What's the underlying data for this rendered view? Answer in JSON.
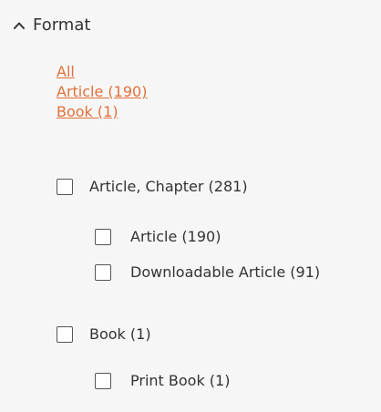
{
  "facet": {
    "title": "Format",
    "quick_links": [
      "All",
      "Article (190)",
      "Book (1)"
    ],
    "options": [
      {
        "label": "Article, Chapter (281)",
        "checked": false,
        "children": [
          {
            "label": "Article (190)",
            "checked": false
          },
          {
            "label": "Downloadable Article (91)",
            "checked": false
          }
        ]
      },
      {
        "label": "Book (1)",
        "checked": false,
        "children": [
          {
            "label": "Print Book (1)",
            "checked": false
          }
        ]
      }
    ]
  },
  "colors": {
    "link": "#e0703a",
    "background": "#f6f6f6",
    "text": "#333333"
  },
  "icons": {
    "collapse": "chevron-up-icon"
  }
}
